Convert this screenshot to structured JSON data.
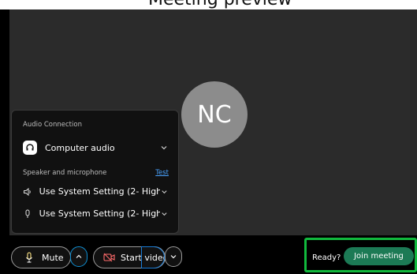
{
  "window": {
    "title": "Meeting preview"
  },
  "avatar": {
    "initials": "NC"
  },
  "audio_panel": {
    "heading": "Audio Connection",
    "connection": {
      "label": "Computer audio",
      "icon": "headset-icon"
    },
    "section_label": "Speaker and microphone",
    "test_link": "Test",
    "speaker": {
      "label": "Use System Setting (2- High ...",
      "icon": "speaker-icon"
    },
    "microphone": {
      "label": "Use System Setting (2- High ...",
      "icon": "microphone-icon"
    }
  },
  "controls": {
    "mute": {
      "label": "Mute",
      "icon": "microphone-icon"
    },
    "video": {
      "label": "Start video",
      "icon": "video-off-icon"
    }
  },
  "join": {
    "ready_text": "Ready?",
    "join_label": "Join meeting"
  },
  "colors": {
    "video_bg": "#2b2b2b",
    "panel_bg": "#111111",
    "link": "#4aa3ff",
    "focus_blue": "#1a7cd6",
    "join_green": "#1c7a55",
    "highlight_green": "#11b93d"
  }
}
